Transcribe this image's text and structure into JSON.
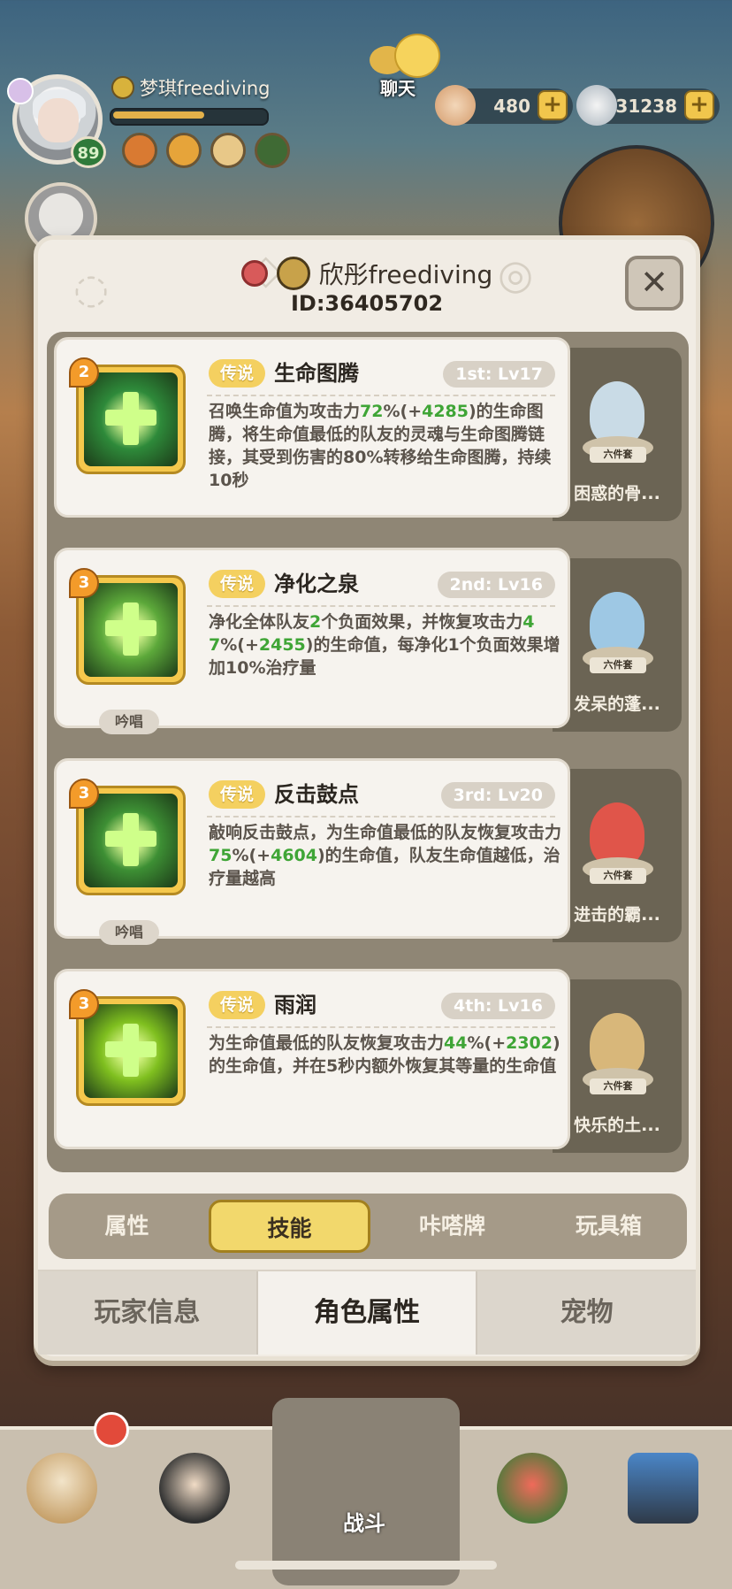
{
  "hud": {
    "player_name": "梦琪freediving",
    "level": "89",
    "exp_fraction": 0.6,
    "chat_label": "聊天",
    "currency1": "480",
    "currency2": "131238"
  },
  "dialog": {
    "player_name": "欣彤freediving",
    "player_id": "ID:36405702",
    "close_symbol": "✕"
  },
  "skills": [
    {
      "rank": "2",
      "tag": "传说",
      "name": "生命图腾",
      "level": "1st: Lv17",
      "desc_parts": [
        "召唤生命值为攻击力",
        "72",
        "%(+",
        "4285",
        ")的生命图腾，将生命值最低的队友的灵魂与生命图腾链接，其受到伤害的80%转移给生命图腾，持续10秒"
      ],
      "chant": "",
      "pet_name": "困惑的骨...",
      "pet_tag": "六件套",
      "icon_color": "#2e8a3a"
    },
    {
      "rank": "3",
      "tag": "传说",
      "name": "净化之泉",
      "level": "2nd: Lv16",
      "desc_parts": [
        "净化全体队友",
        "2",
        "个负面效果，并恢复攻击力",
        "47",
        "%(+",
        "2455",
        ")的生命值，每净化1个负面效果增加10%治疗量"
      ],
      "chant": "吟唱",
      "pet_name": "发呆的蓬...",
      "pet_tag": "六件套",
      "icon_color": "#5ca83a"
    },
    {
      "rank": "3",
      "tag": "传说",
      "name": "反击鼓点",
      "level": "3rd: Lv20",
      "desc_parts": [
        "敲响反击鼓点，为生命值最低的队友恢复攻击力",
        "75",
        "%(+",
        "4604",
        ")的生命值，队友生命值越低，治疗量越高"
      ],
      "chant": "吟唱",
      "pet_name": "进击的霸...",
      "pet_tag": "六件套",
      "icon_color": "#3d8f34"
    },
    {
      "rank": "3",
      "tag": "传说",
      "name": "雨润",
      "level": "4th: Lv16",
      "desc_parts": [
        "为生命值最低的队友恢复攻击力",
        "44",
        "%(+",
        "2302",
        ")的生命值，并在5秒内额外恢复其等量的生命值"
      ],
      "chant": "",
      "pet_name": "快乐的土...",
      "pet_tag": "六件套",
      "icon_color": "#7fbf1f"
    }
  ],
  "subtabs": [
    "属性",
    "技能",
    "咔嗒牌",
    "玩具箱"
  ],
  "maintabs": [
    "玩家信息",
    "角色属性",
    "宠物"
  ],
  "bottom": {
    "battle_label": "战斗"
  },
  "colors": {
    "highlight_green": "#3fa536",
    "tag_gold": "#f4d060",
    "active_tab": "#f2d86c"
  }
}
